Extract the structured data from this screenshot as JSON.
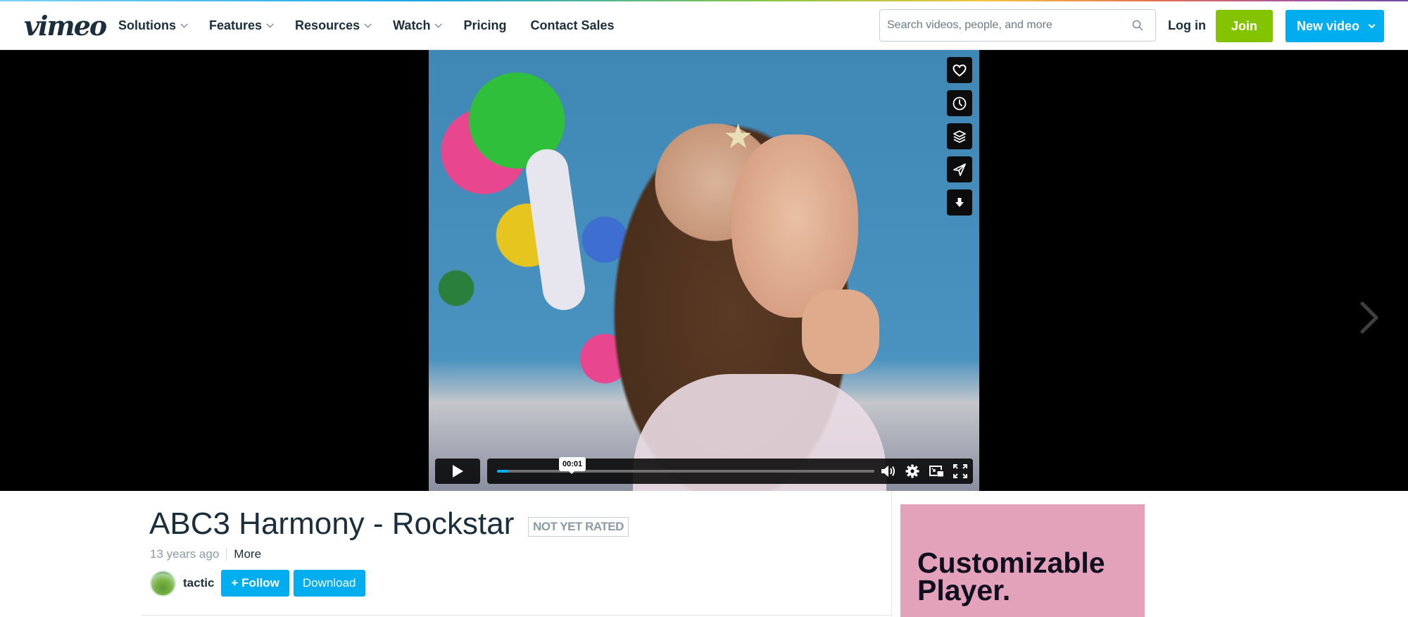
{
  "header": {
    "logo": "vimeo",
    "nav": [
      {
        "label": "Solutions",
        "has_dropdown": true
      },
      {
        "label": "Features",
        "has_dropdown": true
      },
      {
        "label": "Resources",
        "has_dropdown": true
      },
      {
        "label": "Watch",
        "has_dropdown": true
      },
      {
        "label": "Pricing",
        "has_dropdown": false
      },
      {
        "label": "Contact Sales",
        "has_dropdown": false
      }
    ],
    "search": {
      "placeholder": "Search videos, people, and more",
      "value": "",
      "icon": "search-icon"
    },
    "login_label": "Log in",
    "join_label": "Join",
    "new_video_label": "New video",
    "colors": {
      "join": "#84c300",
      "new_video": "#00adef"
    }
  },
  "player": {
    "side_actions": [
      {
        "name": "like",
        "icon": "heart-icon"
      },
      {
        "name": "watch-later",
        "icon": "clock-icon"
      },
      {
        "name": "collections",
        "icon": "layers-icon"
      },
      {
        "name": "share",
        "icon": "send-icon"
      },
      {
        "name": "download",
        "icon": "download-icon"
      }
    ],
    "current_time_tooltip": "00:01",
    "progress_fraction": 0.03,
    "controls": [
      {
        "name": "volume",
        "icon": "volume-icon"
      },
      {
        "name": "settings",
        "icon": "gear-icon"
      },
      {
        "name": "picture-in-picture",
        "icon": "pip-icon"
      },
      {
        "name": "fullscreen",
        "icon": "fullscreen-icon"
      }
    ],
    "accent_color": "#00adef"
  },
  "video": {
    "title": "ABC3 Harmony - Rockstar",
    "rating_badge": "NOT YET RATED",
    "age": "13 years ago",
    "more_label": "More",
    "owner": "tactic",
    "follow_label": "+ Follow",
    "download_label": "Download"
  },
  "ad": {
    "headline": "Customizable Player.",
    "background": "#e4a1ba"
  }
}
